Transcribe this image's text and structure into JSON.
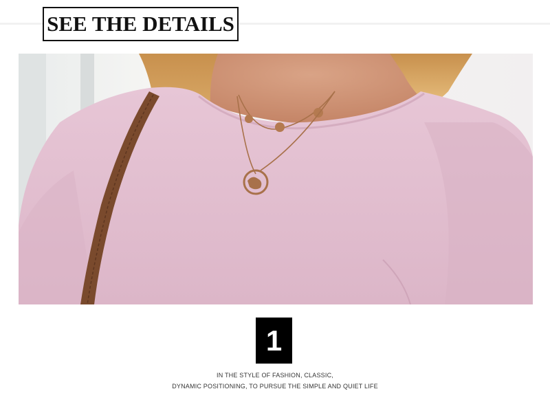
{
  "header": {
    "title": "SEE THE DETAILS"
  },
  "photo": {
    "subject": "pink-top-necklace-photo"
  },
  "detail": {
    "number": "1",
    "caption_line1": "IN THE STYLE OF FASHION, CLASSIC,",
    "caption_line2": "DYNAMIC POSITIONING, TO PURSUE THE SIMPLE AND QUIET LIFE"
  },
  "colors": {
    "garment": "#e2bfd0",
    "hair": "#d9a766",
    "strap": "#7a4a2d",
    "necklace": "#a8714a",
    "title_border": "#111111",
    "number_bg": "#000000"
  }
}
